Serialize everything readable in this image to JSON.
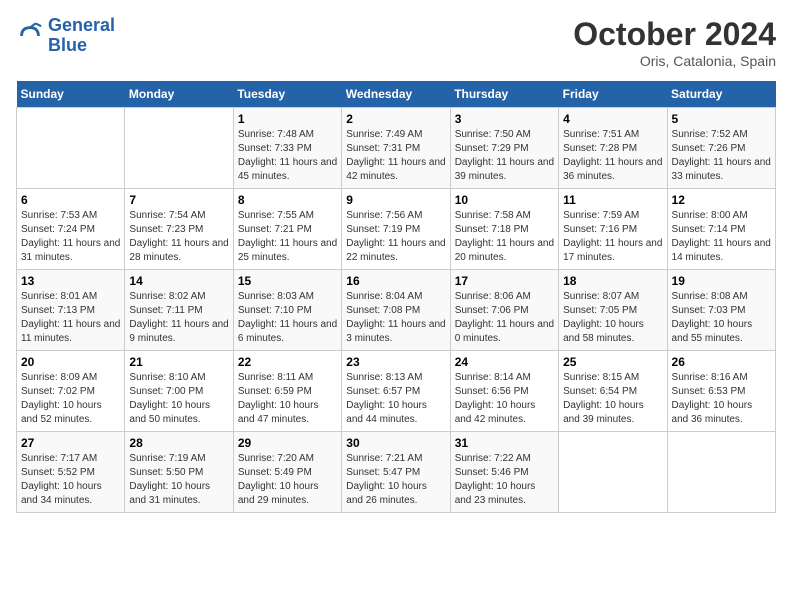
{
  "logo": {
    "text_general": "General",
    "text_blue": "Blue"
  },
  "header": {
    "title": "October 2024",
    "subtitle": "Oris, Catalonia, Spain"
  },
  "columns": [
    "Sunday",
    "Monday",
    "Tuesday",
    "Wednesday",
    "Thursday",
    "Friday",
    "Saturday"
  ],
  "weeks": [
    [
      {
        "num": "",
        "info": ""
      },
      {
        "num": "",
        "info": ""
      },
      {
        "num": "1",
        "info": "Sunrise: 7:48 AM\nSunset: 7:33 PM\nDaylight: 11 hours and 45 minutes."
      },
      {
        "num": "2",
        "info": "Sunrise: 7:49 AM\nSunset: 7:31 PM\nDaylight: 11 hours and 42 minutes."
      },
      {
        "num": "3",
        "info": "Sunrise: 7:50 AM\nSunset: 7:29 PM\nDaylight: 11 hours and 39 minutes."
      },
      {
        "num": "4",
        "info": "Sunrise: 7:51 AM\nSunset: 7:28 PM\nDaylight: 11 hours and 36 minutes."
      },
      {
        "num": "5",
        "info": "Sunrise: 7:52 AM\nSunset: 7:26 PM\nDaylight: 11 hours and 33 minutes."
      }
    ],
    [
      {
        "num": "6",
        "info": "Sunrise: 7:53 AM\nSunset: 7:24 PM\nDaylight: 11 hours and 31 minutes."
      },
      {
        "num": "7",
        "info": "Sunrise: 7:54 AM\nSunset: 7:23 PM\nDaylight: 11 hours and 28 minutes."
      },
      {
        "num": "8",
        "info": "Sunrise: 7:55 AM\nSunset: 7:21 PM\nDaylight: 11 hours and 25 minutes."
      },
      {
        "num": "9",
        "info": "Sunrise: 7:56 AM\nSunset: 7:19 PM\nDaylight: 11 hours and 22 minutes."
      },
      {
        "num": "10",
        "info": "Sunrise: 7:58 AM\nSunset: 7:18 PM\nDaylight: 11 hours and 20 minutes."
      },
      {
        "num": "11",
        "info": "Sunrise: 7:59 AM\nSunset: 7:16 PM\nDaylight: 11 hours and 17 minutes."
      },
      {
        "num": "12",
        "info": "Sunrise: 8:00 AM\nSunset: 7:14 PM\nDaylight: 11 hours and 14 minutes."
      }
    ],
    [
      {
        "num": "13",
        "info": "Sunrise: 8:01 AM\nSunset: 7:13 PM\nDaylight: 11 hours and 11 minutes."
      },
      {
        "num": "14",
        "info": "Sunrise: 8:02 AM\nSunset: 7:11 PM\nDaylight: 11 hours and 9 minutes."
      },
      {
        "num": "15",
        "info": "Sunrise: 8:03 AM\nSunset: 7:10 PM\nDaylight: 11 hours and 6 minutes."
      },
      {
        "num": "16",
        "info": "Sunrise: 8:04 AM\nSunset: 7:08 PM\nDaylight: 11 hours and 3 minutes."
      },
      {
        "num": "17",
        "info": "Sunrise: 8:06 AM\nSunset: 7:06 PM\nDaylight: 11 hours and 0 minutes."
      },
      {
        "num": "18",
        "info": "Sunrise: 8:07 AM\nSunset: 7:05 PM\nDaylight: 10 hours and 58 minutes."
      },
      {
        "num": "19",
        "info": "Sunrise: 8:08 AM\nSunset: 7:03 PM\nDaylight: 10 hours and 55 minutes."
      }
    ],
    [
      {
        "num": "20",
        "info": "Sunrise: 8:09 AM\nSunset: 7:02 PM\nDaylight: 10 hours and 52 minutes."
      },
      {
        "num": "21",
        "info": "Sunrise: 8:10 AM\nSunset: 7:00 PM\nDaylight: 10 hours and 50 minutes."
      },
      {
        "num": "22",
        "info": "Sunrise: 8:11 AM\nSunset: 6:59 PM\nDaylight: 10 hours and 47 minutes."
      },
      {
        "num": "23",
        "info": "Sunrise: 8:13 AM\nSunset: 6:57 PM\nDaylight: 10 hours and 44 minutes."
      },
      {
        "num": "24",
        "info": "Sunrise: 8:14 AM\nSunset: 6:56 PM\nDaylight: 10 hours and 42 minutes."
      },
      {
        "num": "25",
        "info": "Sunrise: 8:15 AM\nSunset: 6:54 PM\nDaylight: 10 hours and 39 minutes."
      },
      {
        "num": "26",
        "info": "Sunrise: 8:16 AM\nSunset: 6:53 PM\nDaylight: 10 hours and 36 minutes."
      }
    ],
    [
      {
        "num": "27",
        "info": "Sunrise: 7:17 AM\nSunset: 5:52 PM\nDaylight: 10 hours and 34 minutes."
      },
      {
        "num": "28",
        "info": "Sunrise: 7:19 AM\nSunset: 5:50 PM\nDaylight: 10 hours and 31 minutes."
      },
      {
        "num": "29",
        "info": "Sunrise: 7:20 AM\nSunset: 5:49 PM\nDaylight: 10 hours and 29 minutes."
      },
      {
        "num": "30",
        "info": "Sunrise: 7:21 AM\nSunset: 5:47 PM\nDaylight: 10 hours and 26 minutes."
      },
      {
        "num": "31",
        "info": "Sunrise: 7:22 AM\nSunset: 5:46 PM\nDaylight: 10 hours and 23 minutes."
      },
      {
        "num": "",
        "info": ""
      },
      {
        "num": "",
        "info": ""
      }
    ]
  ]
}
